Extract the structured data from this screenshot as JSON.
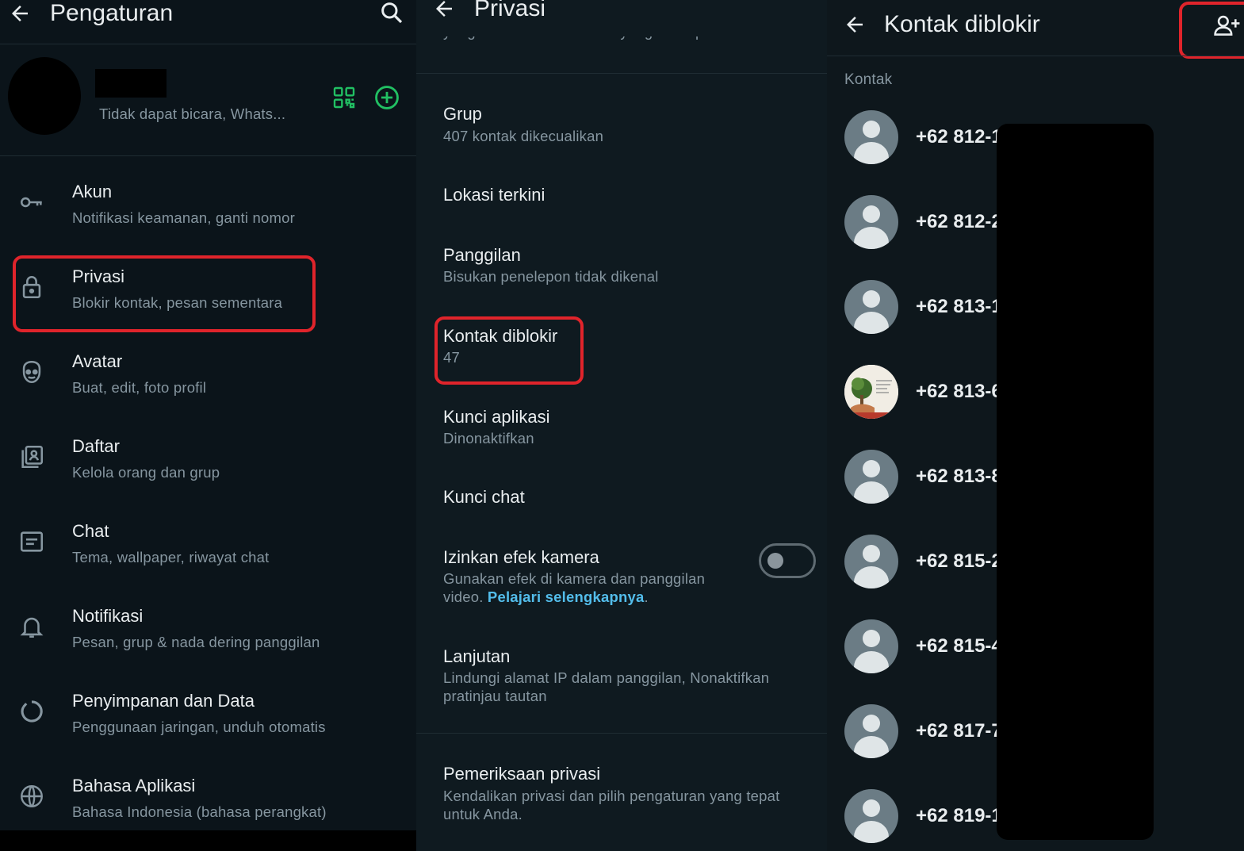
{
  "settings": {
    "title": "Pengaturan",
    "profile_status": "Tidak dapat bicara, Whats...",
    "items": [
      {
        "title": "Akun",
        "sub": "Notifikasi keamanan, ganti nomor",
        "icon": "key-icon"
      },
      {
        "title": "Privasi",
        "sub": "Blokir kontak, pesan sementara",
        "icon": "lock-icon"
      },
      {
        "title": "Avatar",
        "sub": "Buat, edit, foto profil",
        "icon": "avatar-icon"
      },
      {
        "title": "Daftar",
        "sub": "Kelola orang dan grup",
        "icon": "list-icon"
      },
      {
        "title": "Chat",
        "sub": "Tema, wallpaper, riwayat chat",
        "icon": "chat-icon"
      },
      {
        "title": "Notifikasi",
        "sub": "Pesan, grup & nada dering panggilan",
        "icon": "bell-icon"
      },
      {
        "title": "Penyimpanan dan Data",
        "sub": "Penggunaan jaringan, unduh otomatis",
        "icon": "storage-icon"
      },
      {
        "title": "Bahasa Aplikasi",
        "sub": "Bahasa Indonesia (bahasa perangkat)",
        "icon": "globe-icon"
      }
    ]
  },
  "privacy": {
    "title": "Privasi",
    "cut_text": "yang disetel sesuai durasi yang Anda pilih",
    "items": [
      {
        "title": "Grup",
        "sub": "407 kontak dikecualikan"
      },
      {
        "title": "Lokasi terkini",
        "sub": ""
      },
      {
        "title": "Panggilan",
        "sub": "Bisukan penelepon tidak dikenal"
      },
      {
        "title": "Kontak diblokir",
        "sub": "47"
      },
      {
        "title": "Kunci aplikasi",
        "sub": "Dinonaktifkan"
      },
      {
        "title": "Kunci chat",
        "sub": ""
      },
      {
        "title": "Izinkan efek kamera",
        "sub1": "Gunakan efek di kamera dan panggilan",
        "sub2": "video. ",
        "link": "Pelajari selengkapnya",
        "sub3": "."
      },
      {
        "title": "Lanjutan",
        "sub1": "Lindungi alamat IP dalam panggilan, Nonaktifkan",
        "sub2": "pratinjau tautan"
      },
      {
        "title": "Pemeriksaan privasi",
        "sub1": "Kendalikan privasi dan pilih pengaturan yang tepat",
        "sub2": "untuk Anda."
      }
    ],
    "camera_toggle": false
  },
  "blocked": {
    "title": "Kontak diblokir",
    "section": "Kontak",
    "contacts": [
      "+62 812-1",
      "+62 812-2",
      "+62 813-1",
      "+62 813-6",
      "+62 813-8",
      "+62 815-2",
      "+62 815-4",
      "+62 817-7",
      "+62 819-1"
    ]
  },
  "colors": {
    "accent": "#21c063",
    "highlight": "#e0242b",
    "link": "#53bdeb"
  }
}
